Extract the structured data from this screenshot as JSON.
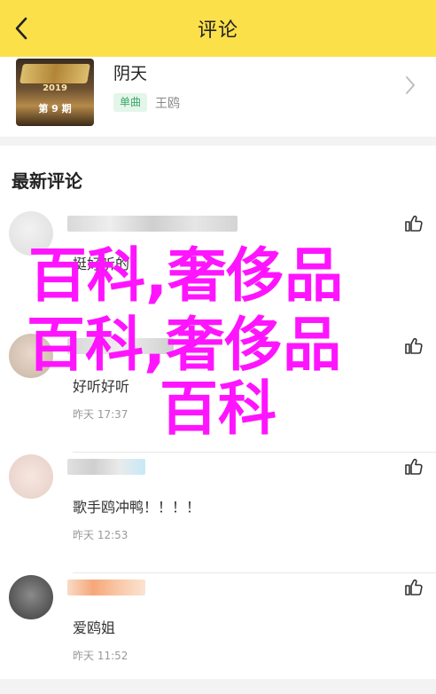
{
  "header": {
    "title": "评论",
    "back_icon": "chevron-left-icon"
  },
  "song": {
    "cover_year": "2019",
    "cover_episode": "第 9 期",
    "name": "阴天",
    "tag": "单曲",
    "artist": "王鸥"
  },
  "section": {
    "title": "最新评论"
  },
  "comments": [
    {
      "text": "挺好听的",
      "time": "",
      "like_icon": "thumb-up-icon"
    },
    {
      "text": "好听好听",
      "time": "昨天 17:37",
      "like_icon": "thumb-up-icon"
    },
    {
      "text": "歌手鸥冲鸭！！！！",
      "time": "昨天 12:53",
      "like_icon": "thumb-up-icon"
    },
    {
      "text": "爱鸥姐",
      "time": "昨天 11:52",
      "like_icon": "thumb-up-icon"
    }
  ],
  "watermark": {
    "line1": "百科,奢侈品",
    "line2": "百科,奢侈品",
    "line3": "百科",
    "color": "#ff14ff"
  },
  "colors": {
    "header_bg": "#fbe04a",
    "tag_text": "#3ca86b",
    "tag_bg": "#e4f6ea"
  }
}
